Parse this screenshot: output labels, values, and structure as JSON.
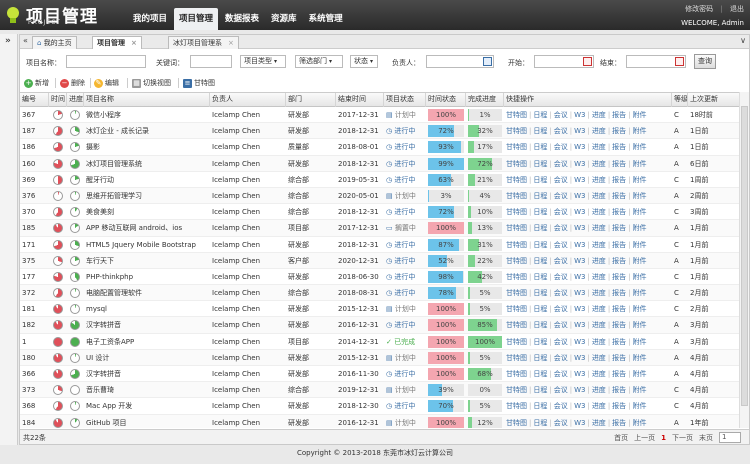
{
  "header": {
    "logo_title": "项目管理",
    "logo_sub": "PROJECT",
    "nav": [
      "我的项目",
      "项目管理",
      "数据报表",
      "资源库",
      "系统管理"
    ],
    "active_nav": 1,
    "links": [
      "修改密码",
      "退出"
    ],
    "welcome": "WELCOME, Admin"
  },
  "sidebar": {
    "toggle": "»"
  },
  "tabs": [
    {
      "label": "我的主页",
      "closable": false
    },
    {
      "label": "项目管理",
      "closable": true,
      "active": true
    },
    {
      "label": "冰灯项目管理系",
      "closable": true
    }
  ],
  "search": {
    "name_label": "项目名称：",
    "keyword_label": "关键词：",
    "type_select": "项目类型",
    "dept_select": "筛选部门",
    "status_select": "状态",
    "owner_label": "负责人：",
    "start_label": "开始：",
    "end_label": "结束：",
    "query_button": "查询"
  },
  "toolbar": {
    "add": "新增",
    "delete": "删除",
    "edit": "编辑",
    "switch_view": "切换视图",
    "gantt": "甘特图"
  },
  "columns": [
    "编号",
    "时间",
    "进度",
    "项目名称",
    "负责人",
    "部门",
    "结束时间",
    "项目状态",
    "时间状态",
    "完成进度",
    "快捷操作",
    "等级",
    "上次更新"
  ],
  "ops_labels": [
    "甘特图",
    "日程",
    "会议",
    "W3",
    "进度",
    "报告",
    "附件"
  ],
  "rows": [
    {
      "id": "367",
      "time_pie": 0.2,
      "prog_pie": 0.05,
      "name": "微信小程序",
      "owner": "Icelamp Chen",
      "dept": "研发部",
      "end": "2017-12-31",
      "status": "计划中",
      "time_pct": 100,
      "time_text": "100%",
      "done_pct": 1,
      "done_text": "1%",
      "level": "C",
      "updated": "18时前"
    },
    {
      "id": "187",
      "time_pie": 0.6,
      "prog_pie": 0.3,
      "name": "冰灯企业 - 成长记录",
      "owner": "Icelamp Chen",
      "dept": "研发部",
      "end": "2018-12-31",
      "status": "进行中",
      "time_pct": 72,
      "time_text": "72%",
      "done_pct": 32,
      "done_text": "32%",
      "level": "A",
      "updated": "1日前"
    },
    {
      "id": "186",
      "time_pie": 0.7,
      "prog_pie": 0.2,
      "name": "摄影",
      "owner": "Icelamp Chen",
      "dept": "质量部",
      "end": "2018-08-01",
      "status": "进行中",
      "time_pct": 93,
      "time_text": "93%",
      "done_pct": 17,
      "done_text": "17%",
      "level": "A",
      "updated": "1日前"
    },
    {
      "id": "160",
      "time_pie": 0.8,
      "prog_pie": 0.7,
      "name": "冰灯项目管理系统",
      "owner": "Icelamp Chen",
      "dept": "研发部",
      "end": "2018-12-31",
      "status": "进行中",
      "time_pct": 99,
      "time_text": "99%",
      "done_pct": 72,
      "done_text": "72%",
      "level": "A",
      "updated": "6日前"
    },
    {
      "id": "369",
      "time_pie": 0.5,
      "prog_pie": 0.2,
      "name": "醒牙行动",
      "owner": "Icelamp Chen",
      "dept": "综合部",
      "end": "2019-05-31",
      "status": "进行中",
      "time_pct": 63,
      "time_text": "63%",
      "done_pct": 21,
      "done_text": "21%",
      "level": "C",
      "updated": "1周前"
    },
    {
      "id": "376",
      "time_pie": 0.05,
      "prog_pie": 0.05,
      "name": "思维开拓管理学习",
      "owner": "Icelamp Chen",
      "dept": "综合部",
      "end": "2020-05-01",
      "status": "计划中",
      "time_pct": 3,
      "time_text": "3%",
      "done_pct": 4,
      "done_text": "4%",
      "level": "A",
      "updated": "2周前"
    },
    {
      "id": "370",
      "time_pie": 0.6,
      "prog_pie": 0.1,
      "name": "美食美刻",
      "owner": "Icelamp Chen",
      "dept": "综合部",
      "end": "2018-12-31",
      "status": "进行中",
      "time_pct": 72,
      "time_text": "72%",
      "done_pct": 10,
      "done_text": "10%",
      "level": "C",
      "updated": "3周前"
    },
    {
      "id": "185",
      "time_pie": 0.9,
      "prog_pie": 0.15,
      "name": "APP 移动互联网 android、ios",
      "owner": "Icelamp Chen",
      "dept": "项目部",
      "end": "2017-12-31",
      "status": "搁置中",
      "time_pct": 100,
      "time_text": "100%",
      "done_pct": 13,
      "done_text": "13%",
      "level": "A",
      "updated": "1月前"
    },
    {
      "id": "171",
      "time_pie": 0.7,
      "prog_pie": 0.3,
      "name": "HTML5 Jquery Mobile Bootstrap",
      "owner": "Icelamp Chen",
      "dept": "研发部",
      "end": "2018-12-31",
      "status": "进行中",
      "time_pct": 87,
      "time_text": "87%",
      "done_pct": 31,
      "done_text": "31%",
      "level": "C",
      "updated": "1月前"
    },
    {
      "id": "375",
      "time_pie": 0.3,
      "prog_pie": 0.2,
      "name": "车行天下",
      "owner": "Icelamp Chen",
      "dept": "客户部",
      "end": "2020-12-31",
      "status": "进行中",
      "time_pct": 52,
      "time_text": "52%",
      "done_pct": 22,
      "done_text": "22%",
      "level": "A",
      "updated": "1月前"
    },
    {
      "id": "177",
      "time_pie": 0.8,
      "prog_pie": 0.4,
      "name": "PHP-thinkphp",
      "owner": "Icelamp Chen",
      "dept": "研发部",
      "end": "2018-06-30",
      "status": "进行中",
      "time_pct": 98,
      "time_text": "98%",
      "done_pct": 42,
      "done_text": "42%",
      "level": "C",
      "updated": "1月前"
    },
    {
      "id": "372",
      "time_pie": 0.6,
      "prog_pie": 0.05,
      "name": "电脑配置管理软件",
      "owner": "Icelamp Chen",
      "dept": "综合部",
      "end": "2018-08-31",
      "status": "进行中",
      "time_pct": 78,
      "time_text": "78%",
      "done_pct": 5,
      "done_text": "5%",
      "level": "C",
      "updated": "2月前"
    },
    {
      "id": "181",
      "time_pie": 0.9,
      "prog_pie": 0.05,
      "name": "mysql",
      "owner": "Icelamp Chen",
      "dept": "研发部",
      "end": "2015-12-31",
      "status": "计划中",
      "time_pct": 100,
      "time_text": "100%",
      "done_pct": 5,
      "done_text": "5%",
      "level": "C",
      "updated": "2月前"
    },
    {
      "id": "182",
      "time_pie": 0.9,
      "prog_pie": 0.85,
      "name": "汉字转拼音",
      "owner": "Icelamp Chen",
      "dept": "研发部",
      "end": "2016-12-31",
      "status": "进行中",
      "time_pct": 100,
      "time_text": "100%",
      "done_pct": 85,
      "done_text": "85%",
      "level": "A",
      "updated": "3月前"
    },
    {
      "id": "1",
      "time_pie": 1.0,
      "prog_pie": 1.0,
      "name": "电子工资条APP",
      "owner": "Icelamp Chen",
      "dept": "项目部",
      "end": "2014-12-31",
      "status": "已完成",
      "time_pct": 100,
      "time_text": "100%",
      "done_pct": 100,
      "done_text": "100%",
      "level": "A",
      "updated": "3月前"
    },
    {
      "id": "180",
      "time_pie": 0.9,
      "prog_pie": 0.05,
      "name": "UI 设计",
      "owner": "Icelamp Chen",
      "dept": "研发部",
      "end": "2015-12-31",
      "status": "计划中",
      "time_pct": 100,
      "time_text": "100%",
      "done_pct": 5,
      "done_text": "5%",
      "level": "A",
      "updated": "4月前"
    },
    {
      "id": "366",
      "time_pie": 0.9,
      "prog_pie": 0.7,
      "name": "汉字转拼音",
      "owner": "Icelamp Chen",
      "dept": "研发部",
      "end": "2016-11-30",
      "status": "进行中",
      "time_pct": 100,
      "time_text": "100%",
      "done_pct": 68,
      "done_text": "68%",
      "level": "A",
      "updated": "4月前"
    },
    {
      "id": "373",
      "time_pie": 0.3,
      "prog_pie": 0.0,
      "name": "音乐曹琦",
      "owner": "Icelamp Chen",
      "dept": "综合部",
      "end": "2019-12-31",
      "status": "计划中",
      "time_pct": 39,
      "time_text": "39%",
      "done_pct": 0,
      "done_text": "0%",
      "level": "C",
      "updated": "4月前"
    },
    {
      "id": "368",
      "time_pie": 0.6,
      "prog_pie": 0.05,
      "name": "Mac App 开发",
      "owner": "Icelamp Chen",
      "dept": "研发部",
      "end": "2018-12-30",
      "status": "进行中",
      "time_pct": 70,
      "time_text": "70%",
      "done_pct": 5,
      "done_text": "5%",
      "level": "C",
      "updated": "4月前"
    },
    {
      "id": "184",
      "time_pie": 0.9,
      "prog_pie": 0.1,
      "name": "GitHub 项目",
      "owner": "Icelamp Chen",
      "dept": "研发部",
      "end": "2016-12-31",
      "status": "计划中",
      "time_pct": 100,
      "time_text": "100%",
      "done_pct": 12,
      "done_text": "12%",
      "level": "A",
      "updated": "1年前"
    }
  ],
  "pager": {
    "total": "共22条",
    "first": "首页",
    "prev": "上一页",
    "current": "1",
    "next": "下一页",
    "last": "末页",
    "page_input": "1"
  },
  "footer": "Copyright © 2013-2018 东莞市冰灯云计算公司",
  "colors": {
    "time_red": "#f4a6b0",
    "time_blue": "#6cc3ea",
    "done_green": "#7ed38f",
    "done_track": "#e8e8e8",
    "pie_red": "#e0505a",
    "pie_green": "#4caf50",
    "link": "#3a6ea5"
  }
}
